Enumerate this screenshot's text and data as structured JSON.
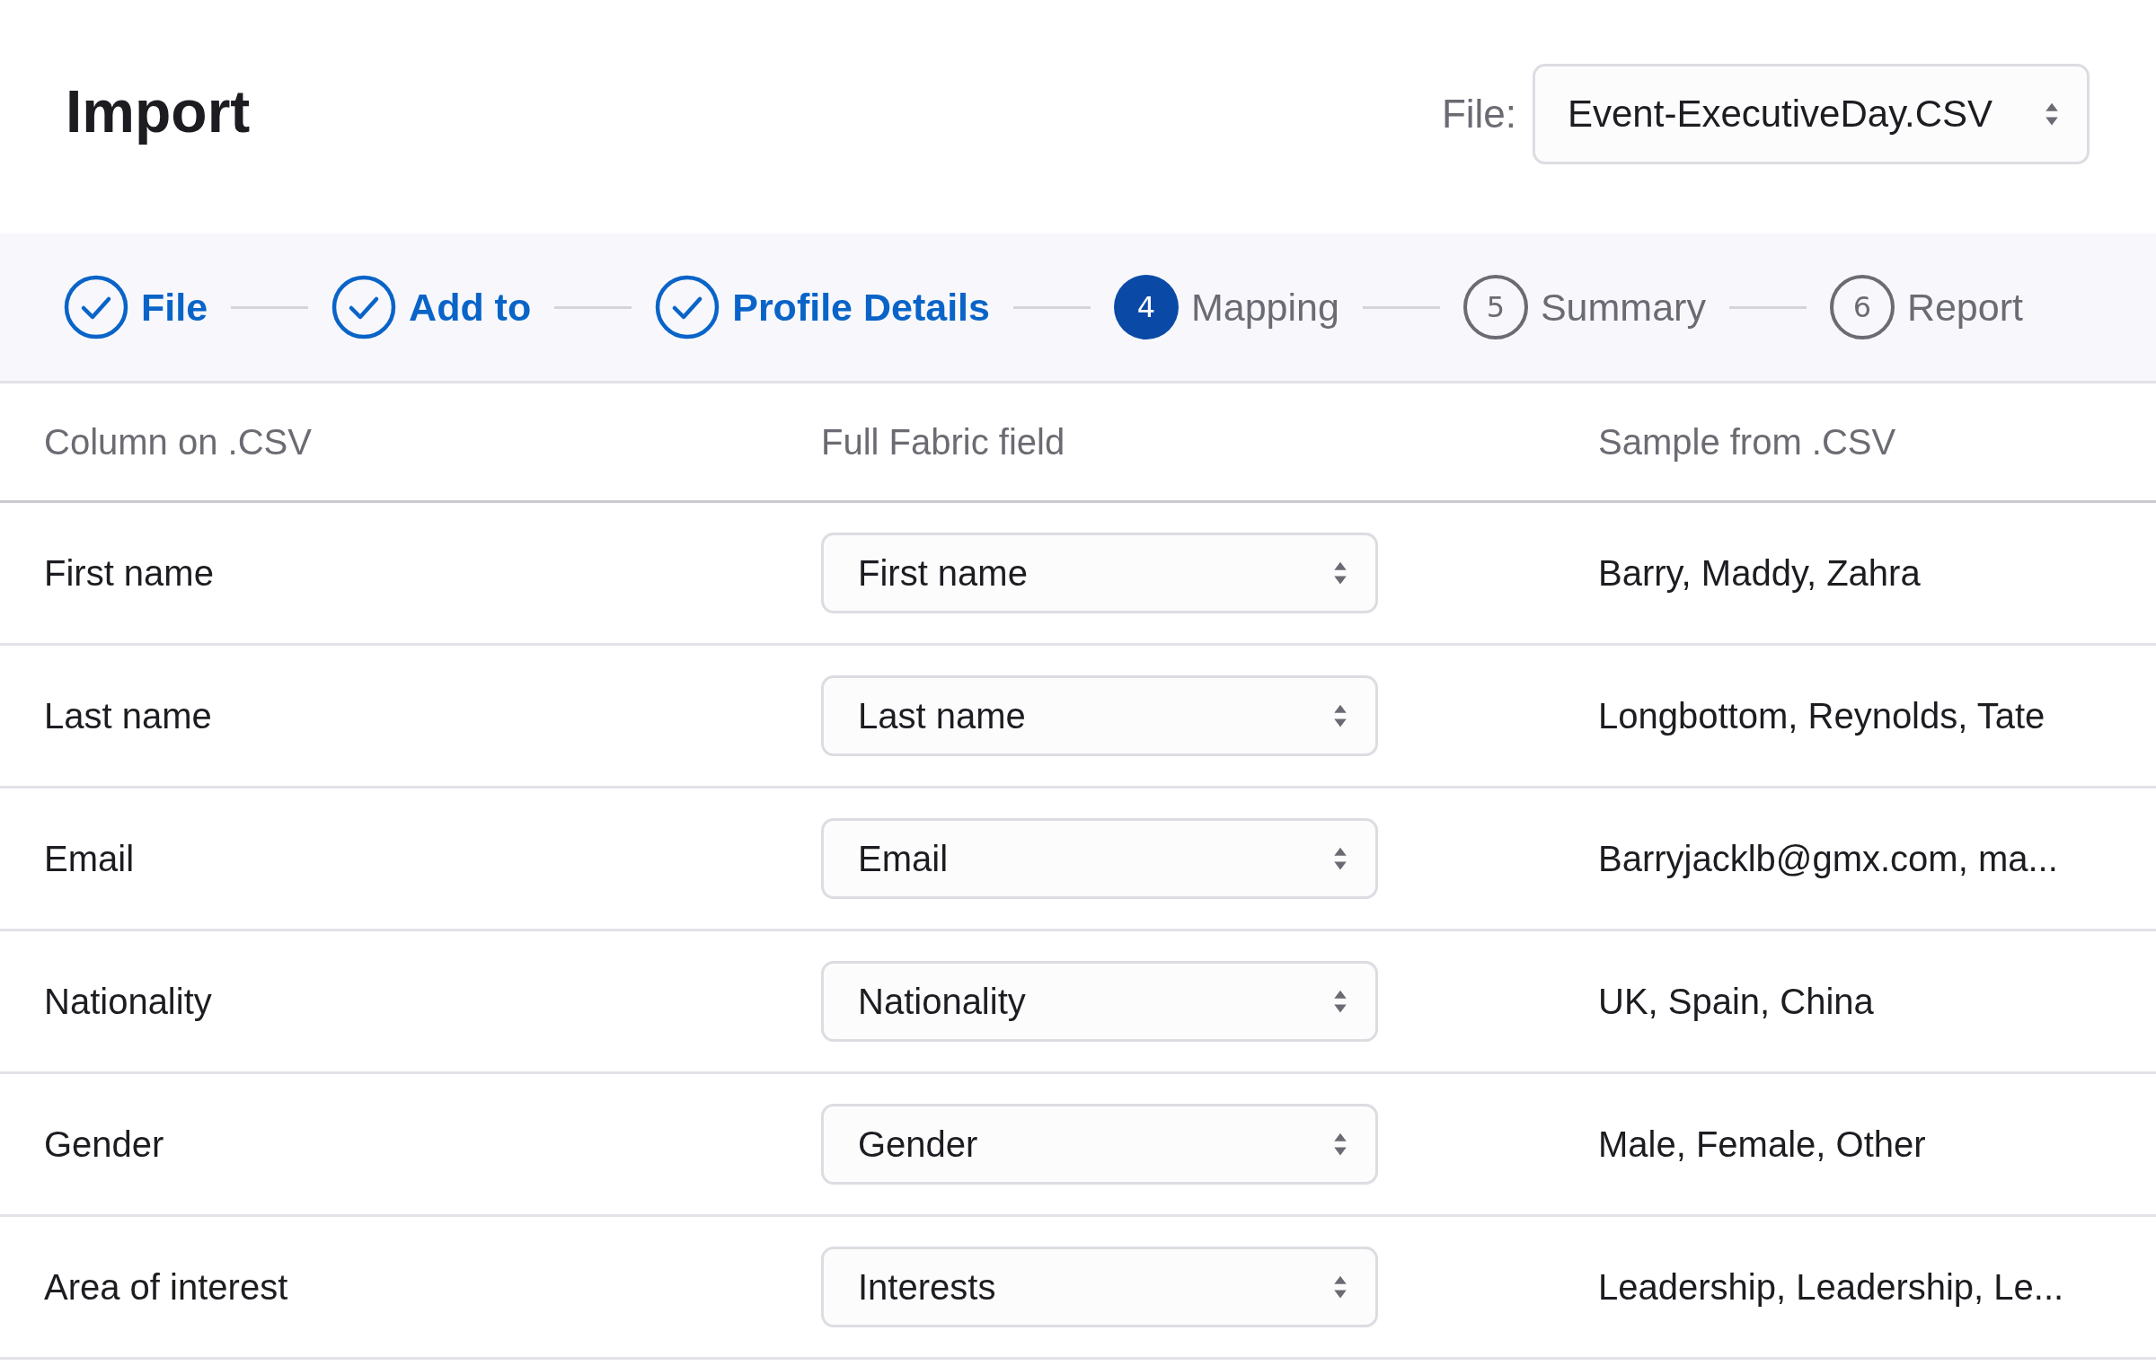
{
  "header": {
    "title": "Import",
    "file_label": "File:",
    "file_value": "Event-ExecutiveDay.CSV"
  },
  "steps": [
    {
      "label": "File",
      "completed": true,
      "current": false
    },
    {
      "label": "Add to",
      "completed": true,
      "current": false
    },
    {
      "label": "Profile Details",
      "completed": true,
      "current": false
    },
    {
      "number": "4",
      "label": "Mapping",
      "completed": false,
      "current": true
    },
    {
      "number": "5",
      "label": "Summary",
      "completed": false,
      "current": false
    },
    {
      "number": "6",
      "label": "Report",
      "completed": false,
      "current": false
    }
  ],
  "table": {
    "columns": [
      "Column on .CSV",
      "Full Fabric field",
      "Sample from .CSV"
    ],
    "rows": [
      {
        "column": "First name",
        "field": "First name",
        "sample": "Barry, Maddy, Zahra"
      },
      {
        "column": "Last name",
        "field": "Last name",
        "sample": "Longbottom, Reynolds, Tate"
      },
      {
        "column": "Email",
        "field": "Email",
        "sample": "Barryjacklb@gmx.com, ma..."
      },
      {
        "column": "Nationality",
        "field": "Nationality",
        "sample": "UK, Spain, China"
      },
      {
        "column": "Gender",
        "field": "Gender",
        "sample": "Male, Female, Other"
      },
      {
        "column": "Area of interest",
        "field": "Interests",
        "sample": "Leadership, Leadership, Le..."
      }
    ]
  }
}
